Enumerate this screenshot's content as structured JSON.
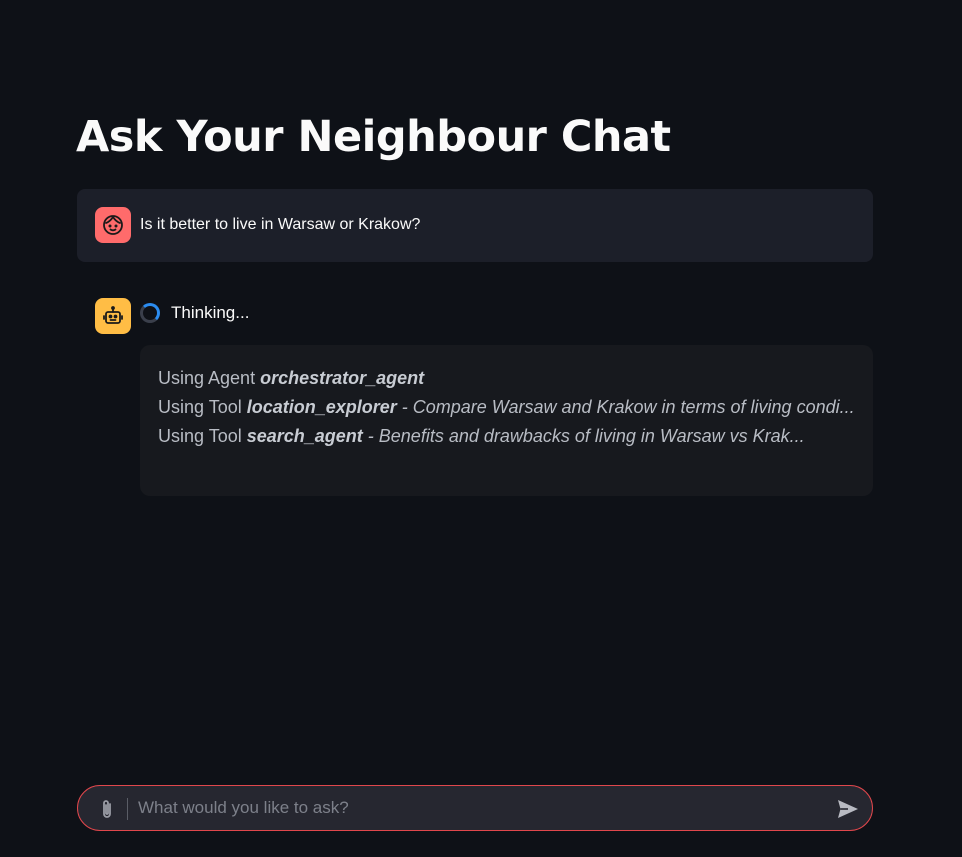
{
  "page": {
    "title": "Ask Your Neighbour Chat"
  },
  "conversation": {
    "user_message": {
      "avatar_icon": "face-icon",
      "avatar_color": "#ff6b6b",
      "text": "Is it better to live in Warsaw or Krakow?"
    },
    "assistant": {
      "avatar_icon": "robot-icon",
      "avatar_color": "#ffbd45",
      "status_text": "Thinking...",
      "steps": [
        {
          "prefix": "Using Agent ",
          "name": "orchestrator_agent",
          "description": ""
        },
        {
          "prefix": "Using Tool ",
          "name": "location_explorer",
          "description": " - Compare Warsaw and Krakow in terms of living condi..."
        },
        {
          "prefix": "Using Tool ",
          "name": "search_agent",
          "description": " - Benefits and drawbacks of living in Warsaw vs Krak..."
        }
      ]
    }
  },
  "chat_input": {
    "placeholder": "What would you like to ask?",
    "value": "",
    "attach_icon": "paperclip-icon",
    "send_icon": "send-icon",
    "accent_color": "#e0474c"
  }
}
